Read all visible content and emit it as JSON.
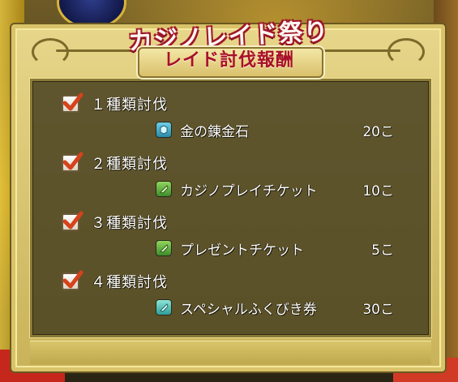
{
  "header": {
    "event_title": "カジノレイド祭り",
    "subtitle": "レイド討伐報酬"
  },
  "rewards": [
    {
      "condition": "１種類討伐",
      "checked": true,
      "item_name": "金の錬金石",
      "item_icon": "alchemy-stone-icon",
      "quantity": "20こ"
    },
    {
      "condition": "２種類討伐",
      "checked": true,
      "item_name": "カジノプレイチケット",
      "item_icon": "ticket-green-icon",
      "quantity": "10こ"
    },
    {
      "condition": "３種類討伐",
      "checked": true,
      "item_name": "プレゼントチケット",
      "item_icon": "ticket-green-icon",
      "quantity": "5こ"
    },
    {
      "condition": "４種類討伐",
      "checked": true,
      "item_name": "スペシャルふくびき券",
      "item_icon": "ticket-cyan-icon",
      "quantity": "30こ"
    }
  ],
  "colors": {
    "panel_gold": "#d9c36a",
    "panel_inner": "#484020",
    "title_red": "#a8102a",
    "check_orange": "#d6421b",
    "text_white": "#ffffff"
  }
}
